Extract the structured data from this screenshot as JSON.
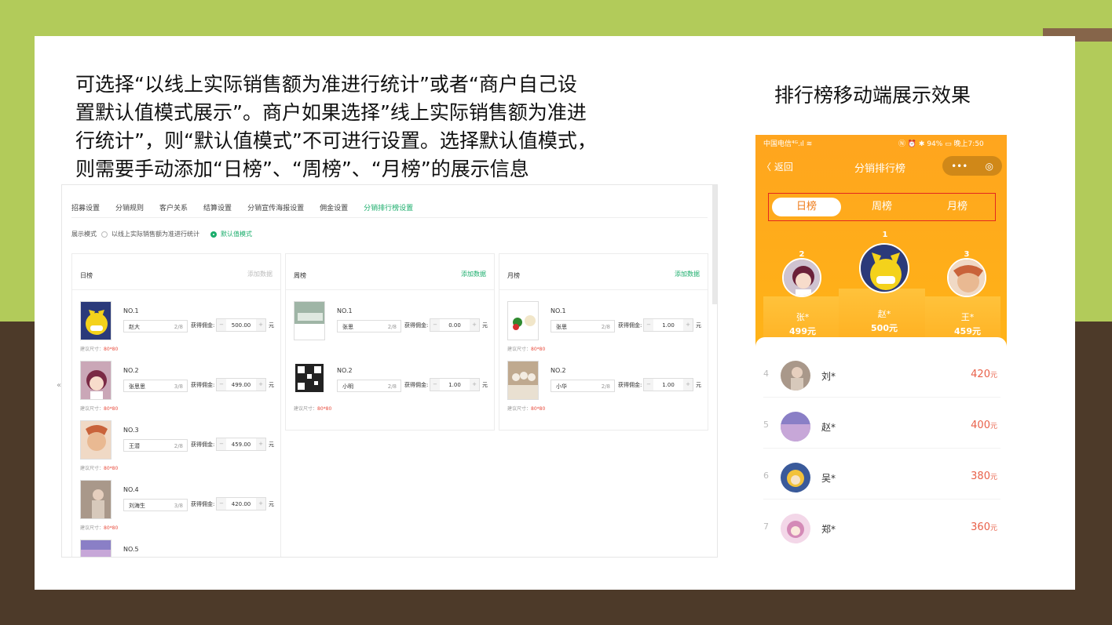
{
  "description_lines": [
    "可选择“以线上实际销售额为准进行统计”或者“商户自己设",
    "置默认值模式展示”。商户如果选择”线上实际销售额为准进",
    "行统计”，则“默认值模式”不可进行设置。选择默认值模式，",
    "则需要手动添加“日榜”、“周榜”、“月榜”的展示信息"
  ],
  "mobile_caption": "排行榜移动端展示效果",
  "admin": {
    "tabs": [
      "招募设置",
      "分销规则",
      "客户关系",
      "结算设置",
      "分销宣传海报设置",
      "佣金设置",
      "分销排行榜设置"
    ],
    "mode_label": "展示模式",
    "mode_option_1": "以线上实际销售额为准进行统计",
    "mode_option_2": "默认值模式",
    "commission_label": "获得佣金:",
    "yuan": "元",
    "size_prefix": "建议尺寸：",
    "size_value": "80*80",
    "collapse_glyph": "«",
    "columns": [
      {
        "title": "日榜",
        "add": "添加数据",
        "entries": [
          {
            "no": "NO.1",
            "name": "赵大",
            "count": "2/8",
            "value": "500.00"
          },
          {
            "no": "NO.2",
            "name": "张思思",
            "count": "3/8",
            "value": "499.00"
          },
          {
            "no": "NO.3",
            "name": "王潜",
            "count": "2/8",
            "value": "459.00"
          },
          {
            "no": "NO.4",
            "name": "刘海生",
            "count": "3/8",
            "value": "420.00"
          },
          {
            "no": "NO.5"
          }
        ]
      },
      {
        "title": "周榜",
        "add": "添加数据",
        "entries": [
          {
            "no": "NO.1",
            "name": "张思",
            "count": "2/8",
            "value": "0.00"
          },
          {
            "no": "NO.2",
            "name": "小明",
            "count": "2/8",
            "value": "1.00"
          }
        ]
      },
      {
        "title": "月榜",
        "add": "添加数据",
        "entries": [
          {
            "no": "NO.1",
            "name": "张思",
            "count": "2/8",
            "value": "1.00"
          },
          {
            "no": "NO.2",
            "name": "小华",
            "count": "2/8",
            "value": "1.00"
          }
        ]
      }
    ]
  },
  "mobile": {
    "status_left": "中国电信⁴ᴳ.ıl ≋",
    "status_right": "Ⓝ ⏰ ✱ 94% ▭ 晚上7:50",
    "back_label": "〈 返回",
    "title": "分销排行榜",
    "capsule_more": "•••",
    "capsule_close": "◎",
    "tabs": [
      "日榜",
      "周榜",
      "月榜"
    ],
    "podium": [
      {
        "rank": "2",
        "name": "张*",
        "amount": "499元"
      },
      {
        "rank": "1",
        "name": "赵*",
        "amount": "500元"
      },
      {
        "rank": "3",
        "name": "王*",
        "amount": "459元"
      }
    ],
    "list": [
      {
        "rank": "4",
        "name": "刘*",
        "amount": "420",
        "unit": "元"
      },
      {
        "rank": "5",
        "name": "赵*",
        "amount": "400",
        "unit": "元"
      },
      {
        "rank": "6",
        "name": "吴*",
        "amount": "380",
        "unit": "元"
      },
      {
        "rank": "7",
        "name": "郑*",
        "amount": "360",
        "unit": "元"
      }
    ]
  },
  "colors": {
    "accent_green": "#1aad6b",
    "mobile_orange": "#ffa51e",
    "price_red": "#e8614a",
    "slide_green": "#b2cb5a",
    "slide_brown": "#4d3a29"
  }
}
